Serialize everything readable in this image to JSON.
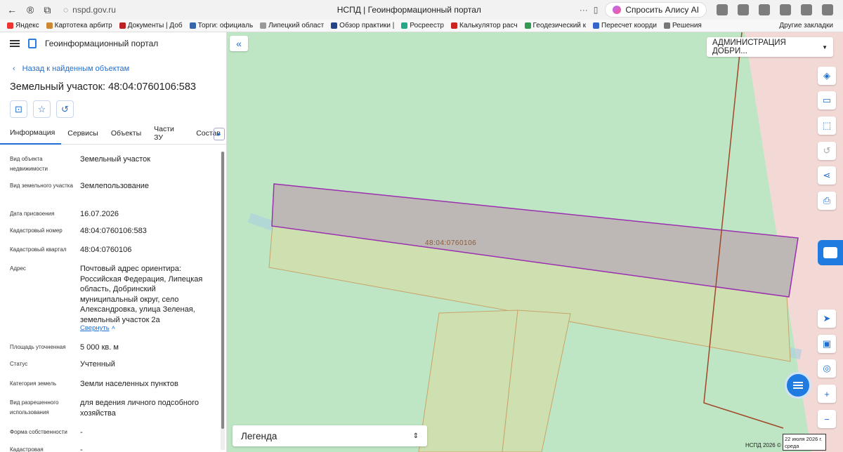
{
  "browser": {
    "url": "nspd.gov.ru",
    "page_title": "НСПД | Геоинформационный портал",
    "alice_label": "Спросить Алису AI",
    "bookmarks": [
      "Яндекс",
      "Картотека арбитр",
      "Документы | Доб",
      "Торги: официаль",
      "Липецкий област",
      "Обзор практики |",
      "Росреестр",
      "Калькулятор расч",
      "Геодезический к",
      "Пересчет коорди",
      "Решения"
    ],
    "other_bookmarks": "Другие закладки"
  },
  "panel": {
    "app_title": "Геоинформационный портал",
    "back_label": "Назад к найденным объектам",
    "object_title": "Земельный участок: 48:04:0760106:583",
    "tabs": [
      "Информация",
      "Сервисы",
      "Объекты",
      "Части ЗУ",
      "Состав"
    ],
    "props": [
      {
        "label": "Вид объекта недвижимости",
        "value": "Земельный участок"
      },
      {
        "label": "Вид земельного участка",
        "value": "Землепользование"
      },
      {
        "label": "Дата присвоения",
        "value": "16.07.2026"
      },
      {
        "label": "Кадастровый номер",
        "value": "48:04:0760106:583"
      },
      {
        "label": "Кадастровый квартал",
        "value": "48:04:0760106"
      },
      {
        "label": "Адрес",
        "value": "Почтовый адрес ориентира: Российская Федерация, Липецкая область, Добринский муниципальный округ, село Александровка, улица Зеленая, земельный участок 2а"
      },
      {
        "label": "Площадь уточненная",
        "value": "5 000 кв. м"
      },
      {
        "label": "Статус",
        "value": "Учтенный"
      },
      {
        "label": "Категория земель",
        "value": "Земли населенных пунктов"
      },
      {
        "label": "Вид разрешенного использования",
        "value": "для ведения личного подсобного хозяйства"
      },
      {
        "label": "Форма собственности",
        "value": "-"
      },
      {
        "label": "Кадастровая",
        "value": "-"
      }
    ],
    "collapse_label": "Свернуть"
  },
  "map": {
    "admin_select": "АДМИНИСТРАЦИЯ ДОБРИ...",
    "parcel_label": "48:04:0760106",
    "legend_label": "Легенда",
    "copyright": "НСПД 2026 ©",
    "date_line1": "22 июля 2026 г.",
    "date_line2": "среда"
  }
}
